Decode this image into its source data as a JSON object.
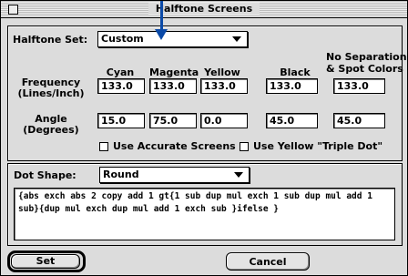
{
  "window": {
    "title": "Halftone Screens"
  },
  "halftone_set": {
    "label": "Halftone Set:",
    "value": "Custom"
  },
  "columns": {
    "cyan": "Cyan",
    "magenta": "Magenta",
    "yellow": "Yellow",
    "black": "Black",
    "no_sep_line1": "No Separations",
    "no_sep_line2": "& Spot Colors"
  },
  "frequency": {
    "label_line1": "Frequency",
    "label_line2": "(Lines/Inch)",
    "cyan": "133.0",
    "magenta": "133.0",
    "yellow": "133.0",
    "black": "133.0",
    "spot": "133.0"
  },
  "angle": {
    "label_line1": "Angle",
    "label_line2": "(Degrees)",
    "cyan": "15.0",
    "magenta": "75.0",
    "yellow": "0.0",
    "black": "45.0",
    "spot": "45.0"
  },
  "options": {
    "accurate_screens": {
      "label": "Use Accurate Screens",
      "checked": false
    },
    "yellow_triple_dot": {
      "label": "Use Yellow \"Triple Dot\"",
      "checked": false
    }
  },
  "dot_shape": {
    "label": "Dot Shape:",
    "value": "Round",
    "postscript": "{abs exch abs 2 copy add 1 gt{1 sub dup mul exch 1 sub dup mul add 1 sub}{dup mul exch dup mul add 1 exch sub }ifelse }"
  },
  "buttons": {
    "set": "Set",
    "cancel": "Cancel"
  },
  "annotation": {
    "arrow_color": "#0b4aa8"
  }
}
